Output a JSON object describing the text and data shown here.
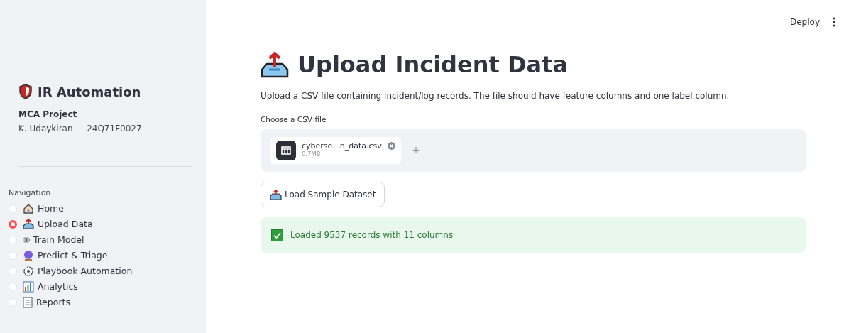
{
  "header": {
    "deploy": "Deploy"
  },
  "sidebar": {
    "title": "IR Automation",
    "project": "MCA Project",
    "author": "K. Udaykiran — 24Q71F0027",
    "nav_label": "Navigation",
    "items": [
      {
        "label": "Home",
        "selected": false
      },
      {
        "label": "Upload Data",
        "selected": true
      },
      {
        "label": "Train Model",
        "selected": false
      },
      {
        "label": "Predict & Triage",
        "selected": false
      },
      {
        "label": "Playbook Automation",
        "selected": false
      },
      {
        "label": "Analytics",
        "selected": false
      },
      {
        "label": "Reports",
        "selected": false
      }
    ]
  },
  "main": {
    "title": "Upload Incident Data",
    "description": "Upload a CSV file containing incident/log records. The file should have feature columns and one label column.",
    "uploader": {
      "label": "Choose a CSV file",
      "file_name": "cyberse...n_data.csv",
      "file_size": "0.7MB",
      "add": "+"
    },
    "sample_button": "Load Sample Dataset",
    "success": "Loaded 9537 records with 11 columns"
  }
}
